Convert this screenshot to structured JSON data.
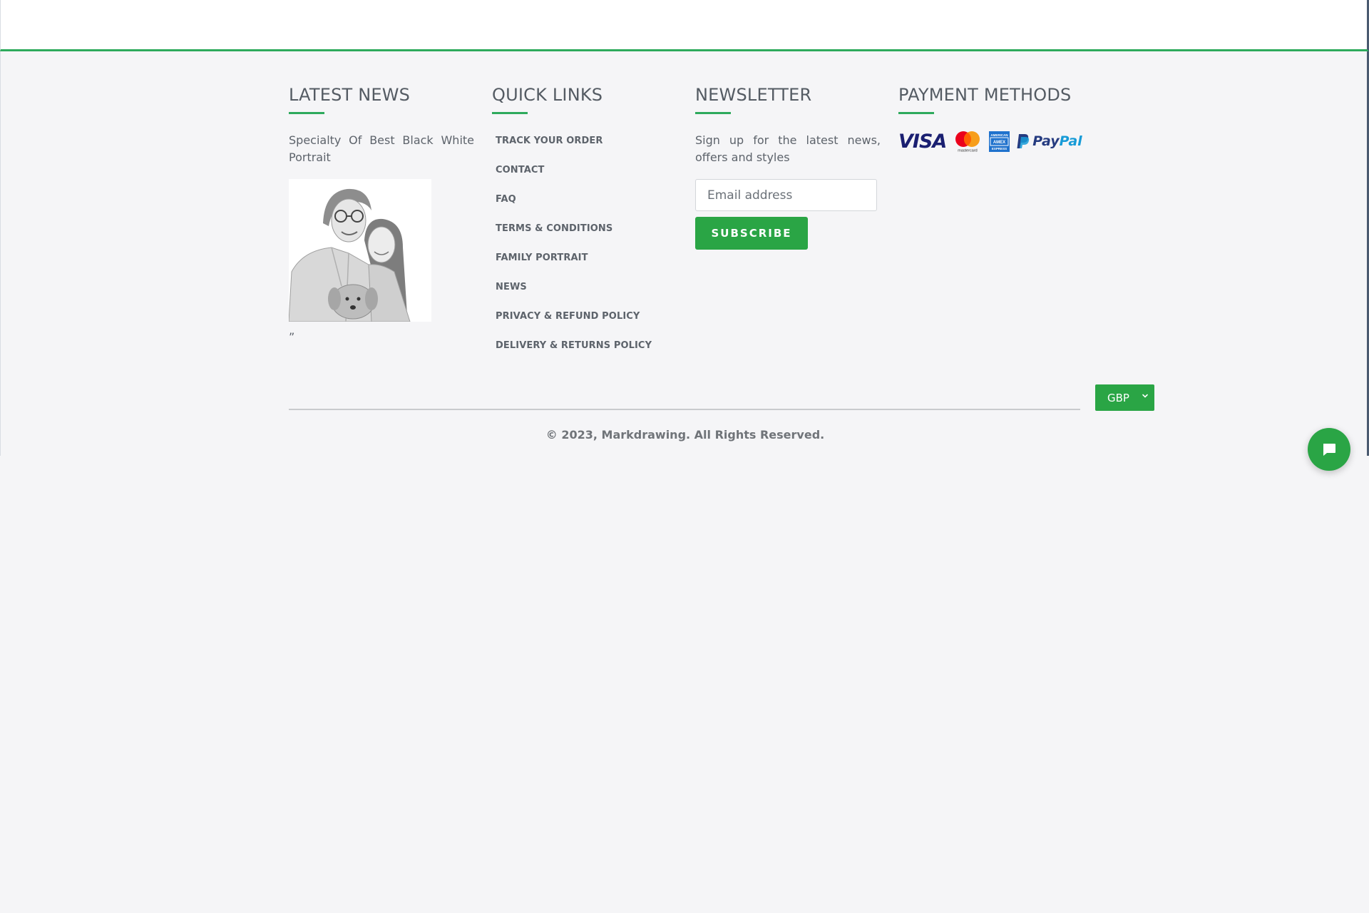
{
  "footer": {
    "latest_news": {
      "title": "LATEST NEWS",
      "post_title": "Specialty Of Best Black White Portrait",
      "image": "pencil-portrait-couple-with-dog",
      "quote_mark": "”"
    },
    "quick_links": {
      "title": "QUICK LINKS",
      "items": [
        {
          "label": "TRACK YOUR ORDER"
        },
        {
          "label": "CONTACT"
        },
        {
          "label": "FAQ"
        },
        {
          "label": "TERMS & CONDITIONS"
        },
        {
          "label": "FAMILY PORTRAIT"
        },
        {
          "label": "NEWS"
        },
        {
          "label": "PRIVACY & REFUND POLICY"
        },
        {
          "label": "DELIVERY & RETURNS POLICY"
        }
      ]
    },
    "newsletter": {
      "title": "NEWSLETTER",
      "description": "Sign up for the latest news, offers and styles",
      "email_placeholder": "Email address",
      "email_value": "",
      "subscribe_label": "SUBSCRIBE"
    },
    "payment_methods": {
      "title": "PAYMENT METHODS",
      "icons": [
        {
          "name": "visa-icon",
          "label": "VISA"
        },
        {
          "name": "mastercard-icon",
          "label": "mastercard"
        },
        {
          "name": "amex-icon",
          "label": "AMERICAN EXPRESS"
        },
        {
          "name": "paypal-icon",
          "label": "PayPal"
        }
      ]
    },
    "currency": {
      "selected": "GBP"
    },
    "copyright": "© 2023, Markdrawing. All Rights Reserved."
  },
  "chat": {
    "icon": "chat-bubble-icon"
  },
  "colors": {
    "accent": "#2aa545",
    "underline": "#2eaa5c",
    "background": "#f5f5f7",
    "text": "#5d636b"
  }
}
